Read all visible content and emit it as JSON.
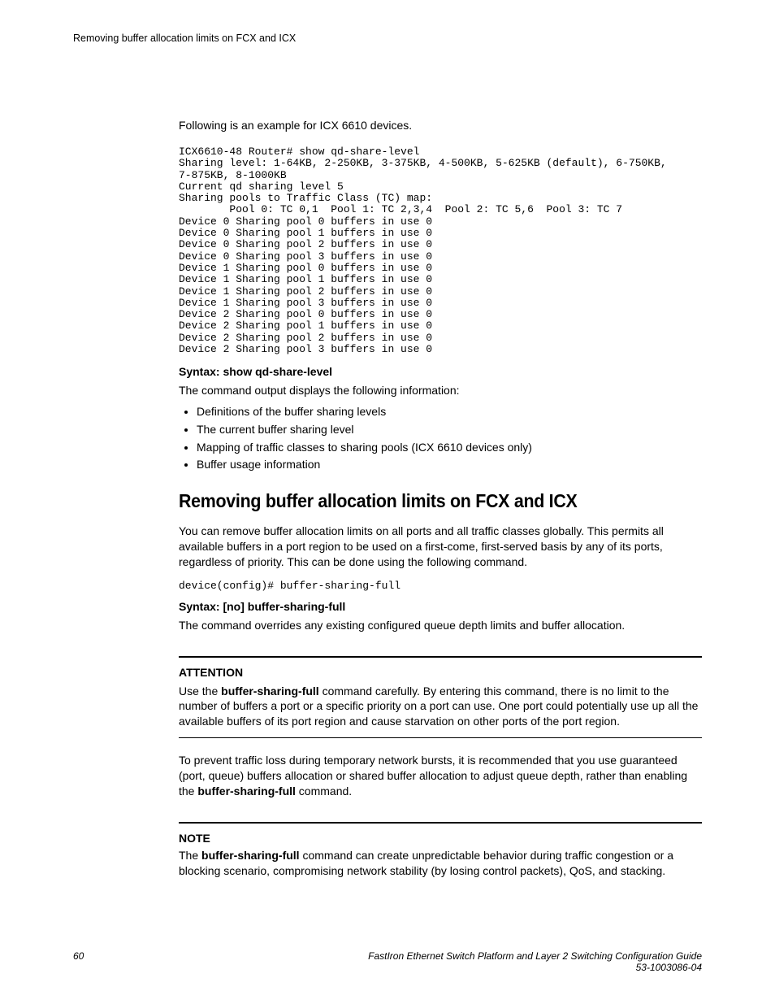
{
  "header": {
    "running_title": "Removing buffer allocation limits on FCX and ICX"
  },
  "section1": {
    "intro": "Following is an example for ICX 6610 devices.",
    "code": "ICX6610-48 Router# show qd-share-level\nSharing level: 1-64KB, 2-250KB, 3-375KB, 4-500KB, 5-625KB (default), 6-750KB,\n7-875KB, 8-1000KB\nCurrent qd sharing level 5\nSharing pools to Traffic Class (TC) map:\n        Pool 0: TC 0,1  Pool 1: TC 2,3,4  Pool 2: TC 5,6  Pool 3: TC 7\nDevice 0 Sharing pool 0 buffers in use 0\nDevice 0 Sharing pool 1 buffers in use 0\nDevice 0 Sharing pool 2 buffers in use 0\nDevice 0 Sharing pool 3 buffers in use 0\nDevice 1 Sharing pool 0 buffers in use 0\nDevice 1 Sharing pool 1 buffers in use 0\nDevice 1 Sharing pool 2 buffers in use 0\nDevice 1 Sharing pool 3 buffers in use 0\nDevice 2 Sharing pool 0 buffers in use 0\nDevice 2 Sharing pool 1 buffers in use 0\nDevice 2 Sharing pool 2 buffers in use 0\nDevice 2 Sharing pool 3 buffers in use 0",
    "syntax": "Syntax: show qd-share-level",
    "output_desc": "The command output displays the following information:",
    "bullets": [
      "Definitions of the buffer sharing levels",
      "The current buffer sharing level",
      "Mapping of traffic classes to sharing pools (ICX 6610 devices only)",
      "Buffer usage information"
    ]
  },
  "section2": {
    "heading": "Removing buffer allocation limits on FCX and ICX",
    "para1": "You can remove buffer allocation limits on all ports and all traffic classes globally. This permits all available buffers in a port region to be used on a first-come, first-served basis by any of its ports, regardless of priority. This can be done using the following command.",
    "cmd": "device(config)# buffer-sharing-full",
    "syntax": "Syntax: [no] buffer-sharing-full",
    "para2": "The command overrides any existing configured queue depth limits and buffer allocation.",
    "attention": {
      "title": "ATTENTION",
      "body_pre": "Use the ",
      "body_strong1": "buffer-sharing-full",
      "body_post": " command carefully. By entering this command, there is no limit to the number of buffers a port or a specific priority on a port can use. One port could potentially use up all the available buffers of its port region and cause starvation on other ports of the port region."
    },
    "para3_pre": "To prevent traffic loss during temporary network bursts, it is recommended that you use guaranteed (port, queue) buffers allocation or shared buffer allocation to adjust queue depth, rather than enabling the ",
    "para3_strong": "buffer-sharing-full",
    "para3_post": " command.",
    "note": {
      "title": "NOTE",
      "body_pre": "The ",
      "body_strong": "buffer-sharing-full",
      "body_post": " command can create unpredictable behavior during traffic congestion or a blocking scenario, compromising network stability (by losing control packets), QoS, and stacking."
    }
  },
  "footer": {
    "page": "60",
    "title": "FastIron Ethernet Switch Platform and Layer 2 Switching Configuration Guide",
    "docnum": "53-1003086-04"
  }
}
